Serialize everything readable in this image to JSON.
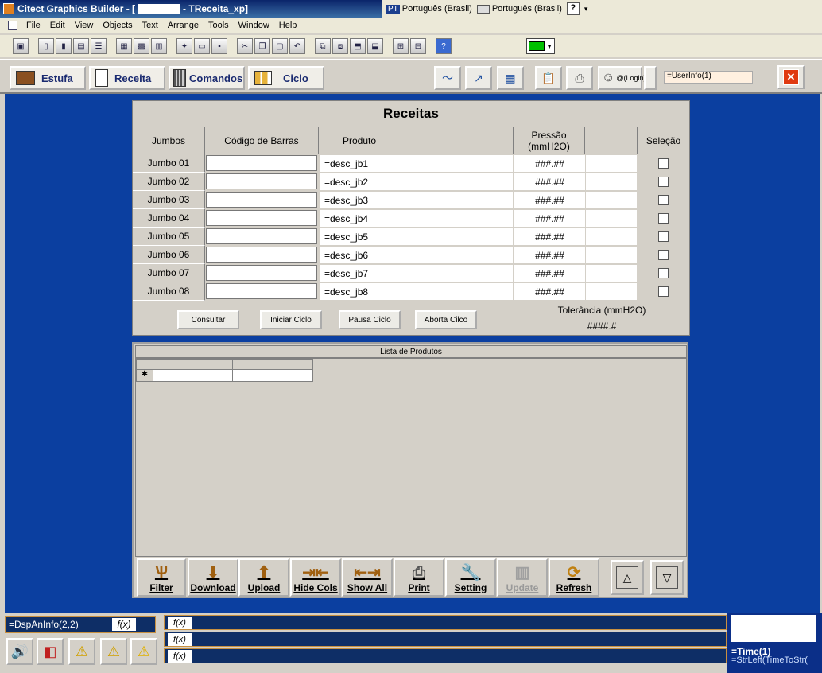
{
  "window": {
    "title": "Citect Graphics Builder - [",
    "title_suffix": " - TReceita_xp]"
  },
  "langbar": {
    "lang1_code": "PT",
    "lang1": "Português (Brasil)",
    "lang2": "Português (Brasil)",
    "help": "?"
  },
  "menu": [
    "File",
    "Edit",
    "View",
    "Objects",
    "Text",
    "Arrange",
    "Tools",
    "Window",
    "Help"
  ],
  "toolbar_color": "#00c000",
  "nav": {
    "estufa": "Estufa",
    "receita": "Receita",
    "comandos": "Comandos",
    "ciclo": "Ciclo",
    "login": "@(Login)",
    "userinfo": "=UserInfo(1)"
  },
  "recipe": {
    "title": "Receitas",
    "headers": {
      "jumbos": "Jumbos",
      "codigo": "Código de Barras",
      "produto": "Produto",
      "pressao": "Pressão\n(mmH2O)",
      "selecao": "Seleção"
    },
    "rows": [
      {
        "label": "Jumbo 01",
        "produto": "=desc_jb1",
        "pressao": "###.##"
      },
      {
        "label": "Jumbo 02",
        "produto": "=desc_jb2",
        "pressao": "###.##"
      },
      {
        "label": "Jumbo 03",
        "produto": "=desc_jb3",
        "pressao": "###.##"
      },
      {
        "label": "Jumbo 04",
        "produto": "=desc_jb4",
        "pressao": "###.##"
      },
      {
        "label": "Jumbo 05",
        "produto": "=desc_jb5",
        "pressao": "###.##"
      },
      {
        "label": "Jumbo 06",
        "produto": "=desc_jb6",
        "pressao": "###.##"
      },
      {
        "label": "Jumbo 07",
        "produto": "=desc_jb7",
        "pressao": "###.##"
      },
      {
        "label": "Jumbo 08",
        "produto": "=desc_jb8",
        "pressao": "###.##"
      }
    ],
    "buttons": {
      "consultar": "Consultar",
      "iniciar": "Iniciar Ciclo",
      "pausa": "Pausa Ciclo",
      "aborta": "Aborta Cilco"
    },
    "tolerancia_label": "Tolerância (mmH2O)",
    "tolerancia_value": "####.#"
  },
  "lista": {
    "title": "Lista de Produtos",
    "new_row_marker": "✱",
    "buttons": {
      "filter": "Filter",
      "download": "Download",
      "upload": "Upload",
      "hidecols": "Hide Cols",
      "showall": "Show All",
      "print": "Print",
      "setting": "Setting",
      "update": "Update",
      "refresh": "Refresh"
    }
  },
  "bottom": {
    "leftfield": "=DspAnInfo(2,2)",
    "fx": "f(x)",
    "time": "=Time(1)",
    "strleft": "=StrLeft(TimeToStr("
  }
}
